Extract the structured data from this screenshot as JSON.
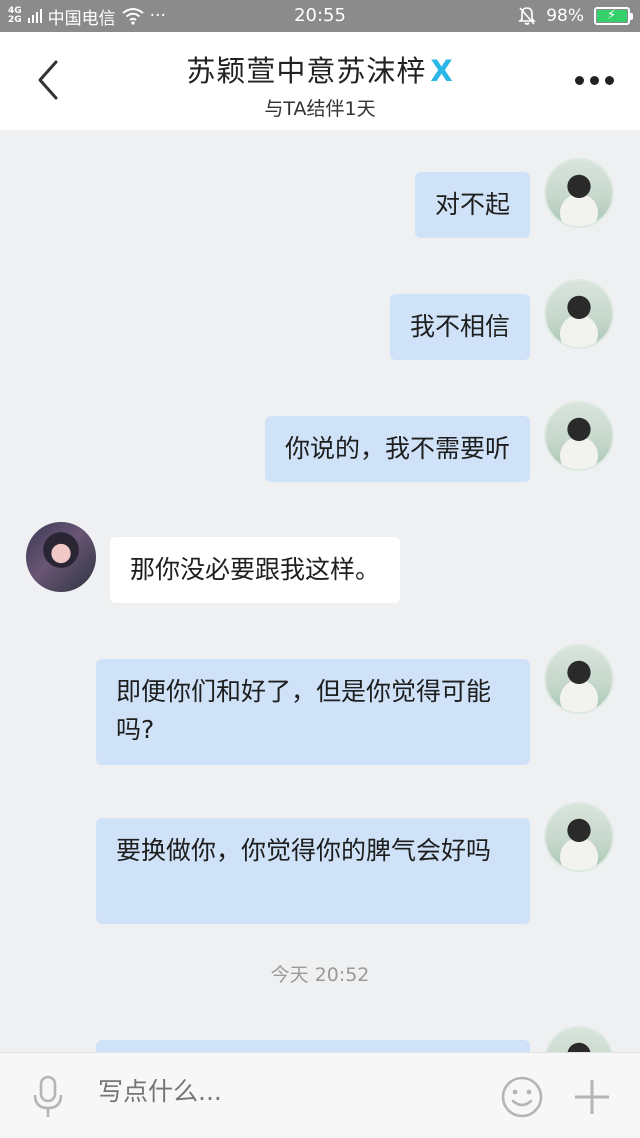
{
  "status_bar": {
    "network_top": "4G",
    "network_bottom": "2G",
    "carrier": "中国电信",
    "dots": "···",
    "time": "20:55",
    "battery": "98%"
  },
  "header": {
    "title": "苏颖萱中意苏沫梓",
    "badge": "X",
    "subtitle": "与TA结伴1天"
  },
  "messages": [
    {
      "side": "me",
      "text": "对不起"
    },
    {
      "side": "me",
      "text": "我不相信"
    },
    {
      "side": "me",
      "text": "你说的，我不需要听"
    },
    {
      "side": "other",
      "text": "那你没必要跟我这样。"
    },
    {
      "side": "me",
      "text": "即便你们和好了，但是你觉得可能吗?"
    },
    {
      "side": "me",
      "text": "要换做你，你觉得你的脾气会好吗"
    }
  ],
  "timestamp": "今天 20:52",
  "input": {
    "placeholder": "写点什么..."
  },
  "icons": {
    "back": "chevron-left-icon",
    "more": "more-dots-icon",
    "mic": "microphone-icon",
    "emoji": "smiley-icon",
    "plus": "plus-icon"
  },
  "colors": {
    "my_bubble": "#cfe2f8",
    "other_bubble": "#ffffff",
    "chat_background": "#eef0f2",
    "badge": "#2ab7e8",
    "battery_fill": "#35d06b"
  }
}
